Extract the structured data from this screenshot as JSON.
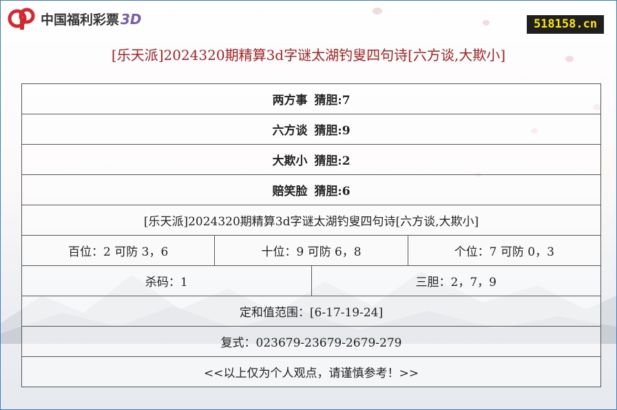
{
  "header": {
    "logo_text": "中国福利彩票",
    "logo_suffix": "3D",
    "site_badge": "518158.cn"
  },
  "title": "[乐天派]2024320期精算3d字谜太湖钓叟四句诗[六方谈,大欺小]",
  "colors": {
    "title": "#b01e1e",
    "badge_bg": "#1f1f1f",
    "badge_text": "#ffe600",
    "logo_red": "#d7262c",
    "border": "#3a7bd5"
  },
  "verses": [
    {
      "phrase": "两方事",
      "guess": "猜胆:7"
    },
    {
      "phrase": "六方谈",
      "guess": "猜胆:9"
    },
    {
      "phrase": "大欺小",
      "guess": "猜胆:2"
    },
    {
      "phrase": "赔笑脸",
      "guess": "猜胆:6"
    }
  ],
  "summary_title": "[乐天派]2024320期精算3d字谜太湖钓叟四句诗[六方谈,大欺小]",
  "positions": [
    "百位：2 可防 3，6",
    "十位：9 可防 6，8",
    "个位：7 可防 0，3"
  ],
  "kill": "杀码：1",
  "three_dan": "三胆：2，7，9",
  "sum_range": "定和值范围：[6-17-19-24]",
  "combo": "复式：023679-23679-2679-279",
  "disclaimer": "<<以上仅为个人观点，请谨慎参考！>>"
}
